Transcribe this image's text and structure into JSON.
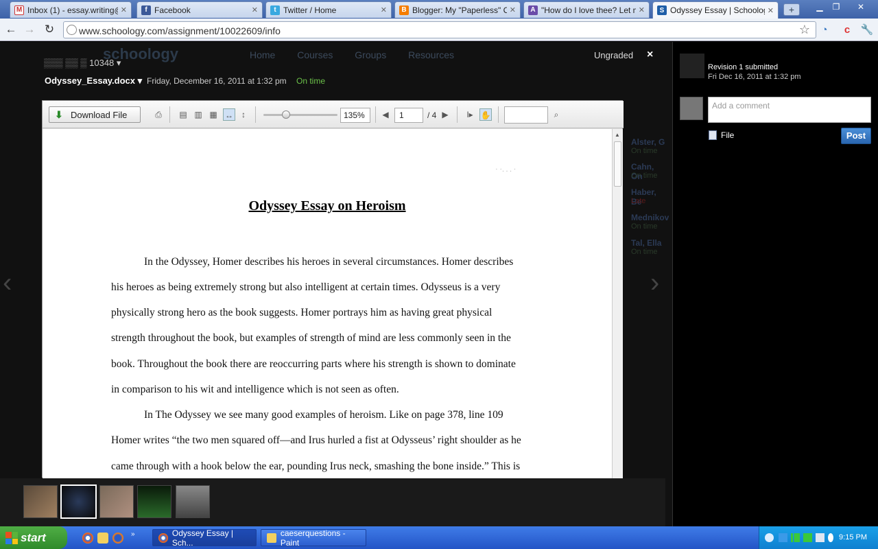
{
  "browser": {
    "tabs": [
      {
        "label": "Inbox (1) - essay.writing@gn",
        "icon": "gmail-icon",
        "active": false
      },
      {
        "label": "Facebook",
        "icon": "facebook-icon",
        "active": false
      },
      {
        "label": "Twitter / Home",
        "icon": "twitter-icon",
        "active": false
      },
      {
        "label": "Blogger: My \"Paperless\" Clas",
        "icon": "blogger-icon",
        "active": false
      },
      {
        "label": "\"How do I love thee? Let me",
        "icon": "generic-site-icon",
        "active": false
      },
      {
        "label": "Odyssey Essay | Schoology",
        "icon": "schoology-icon",
        "active": true
      }
    ],
    "url": "www.schoology.com/assignment/10022609/info"
  },
  "background_page": {
    "logo": "schoology",
    "nav": [
      "Home",
      "Courses",
      "Groups",
      "Resources"
    ],
    "side_names": [
      {
        "name": "Alster, G",
        "status": "On time"
      },
      {
        "name": "Cahn, On",
        "status": "On time"
      },
      {
        "name": "Haber, Be",
        "status": "Late"
      },
      {
        "name": "Mednikov",
        "status": "On time"
      },
      {
        "name": "Tal, Ella",
        "status": "On time"
      }
    ]
  },
  "viewer": {
    "grade_status": "Ungraded",
    "close_label": "×",
    "student_suffix": "10348",
    "filename": "Odyssey_Essay.docx",
    "submitted_date": "Friday, December 16, 2011 at 1:32 pm",
    "timeliness": "On time",
    "download_label": "Download File",
    "zoom": "135%",
    "zoom_level_fraction": 0.28,
    "page_current": "1",
    "page_total": "/ 4"
  },
  "document": {
    "title": "Odyssey Essay on Heroism",
    "lines": [
      "In the Odyssey, Homer describes his heroes in several circumstances. Homer describes",
      "his heroes as being extremely strong but also intelligent at certain times. Odysseus is a very",
      "physically strong hero as the book suggests. Homer portrays him as having great physical",
      "strength throughout the book, but examples of strength of mind are less commonly seen in the",
      "book. Throughout the book there are reoccurring parts where his strength is shown to dominate",
      "in comparison to his wit and intelligence which is not seen as often.",
      "In The Odyssey we see many good examples of heroism. Like on page 378, line 109",
      "Homer writes “the two men squared off—and Irus hurled a fist at Odysseus’ right shoulder as he",
      "came through with a hook below the ear, pounding Irus neck, smashing the bone inside.” This is"
    ]
  },
  "comments": {
    "revision": "Revision 1 submitted",
    "revision_date": "Fri Dec 16, 2011 at 1:32 pm",
    "placeholder": "Add a comment",
    "file_label": "File",
    "post_label": "Post"
  },
  "taskbar": {
    "start_label": "start",
    "items": [
      {
        "label": "Odyssey Essay | Sch...",
        "active": true
      },
      {
        "label": "caeserquestions - Paint",
        "active": false
      }
    ],
    "clock": "9:15 PM"
  },
  "colors": {
    "on_time": "#6cc24a",
    "late": "#c0392b",
    "post_button": "#2a66b0",
    "taskbar": "#2354c6"
  }
}
